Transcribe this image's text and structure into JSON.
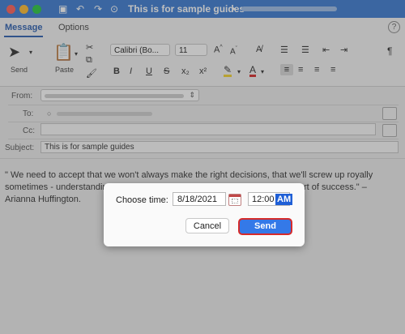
{
  "window": {
    "title": "This is for sample guides",
    "title_suffix": "•"
  },
  "ribbon": {
    "tabs": [
      "Message",
      "Options"
    ],
    "send_label": "Send",
    "paste_label": "Paste",
    "font_name": "Calibri (Bo...",
    "font_size": "11",
    "format_buttons": [
      "B",
      "I",
      "U",
      "S",
      "x₂",
      "x²"
    ]
  },
  "fields": {
    "from_label": "From:",
    "to_label": "To:",
    "cc_label": "Cc:",
    "subject_label": "Subject:",
    "subject_value": "This is for sample guides"
  },
  "body": {
    "text": "\" We need to accept that we won't always make the right decisions, that we'll screw up royally sometimes - understanding that failure is not the opposite of success, it's part of success.\" – Arianna Huffington."
  },
  "dialog": {
    "label": "Choose time:",
    "date": "8/18/2021",
    "time": "12:00",
    "ampm": "AM",
    "cancel_label": "Cancel",
    "send_label": "Send"
  },
  "colors": {
    "titlebar": "#3b7bd1",
    "send_button": "#3479e8",
    "highlight_border": "#d62a2a"
  }
}
